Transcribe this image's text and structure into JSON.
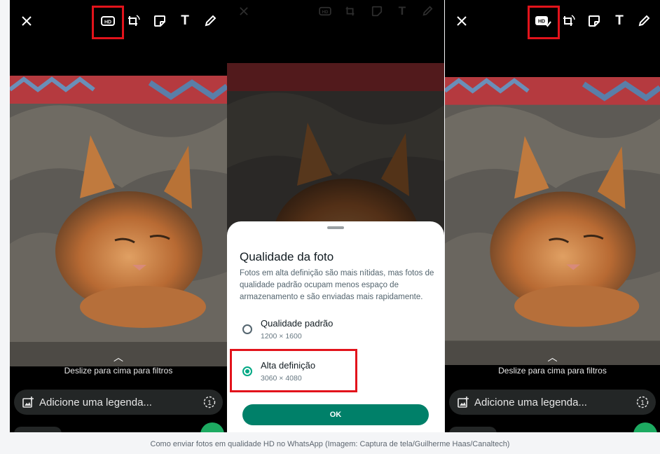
{
  "hint_text": "Deslize para cima para filtros",
  "caption_placeholder": "Adicione uma legenda...",
  "toolbar": {
    "close_icon": "close-icon",
    "hd_icon": "hd-icon",
    "hd_label": "HD",
    "icons": [
      "crop-rotate-icon",
      "sticker-icon",
      "text-icon",
      "pencil-icon"
    ],
    "text_glyph": "T"
  },
  "sheet": {
    "title": "Qualidade da foto",
    "description": "Fotos em alta definição são mais nítidas, mas fotos de qualidade padrão ocupam menos espaço de armazenamento e são enviadas mais rapidamente.",
    "options": [
      {
        "label": "Qualidade padrão",
        "resolution": "1200 × 1600",
        "selected": false
      },
      {
        "label": "Alta definição",
        "resolution": "3060 × 4080",
        "selected": true
      }
    ],
    "ok_label": "OK"
  },
  "footer_caption": "Como enviar fotos em qualidade HD no WhatsApp (Imagem: Captura de tela/Guilherme Haas/Canaltech)",
  "colors": {
    "highlight": "#e2131b",
    "whatsapp_green": "#008069",
    "radio_green": "#00a884",
    "send_green": "#1daa61"
  }
}
